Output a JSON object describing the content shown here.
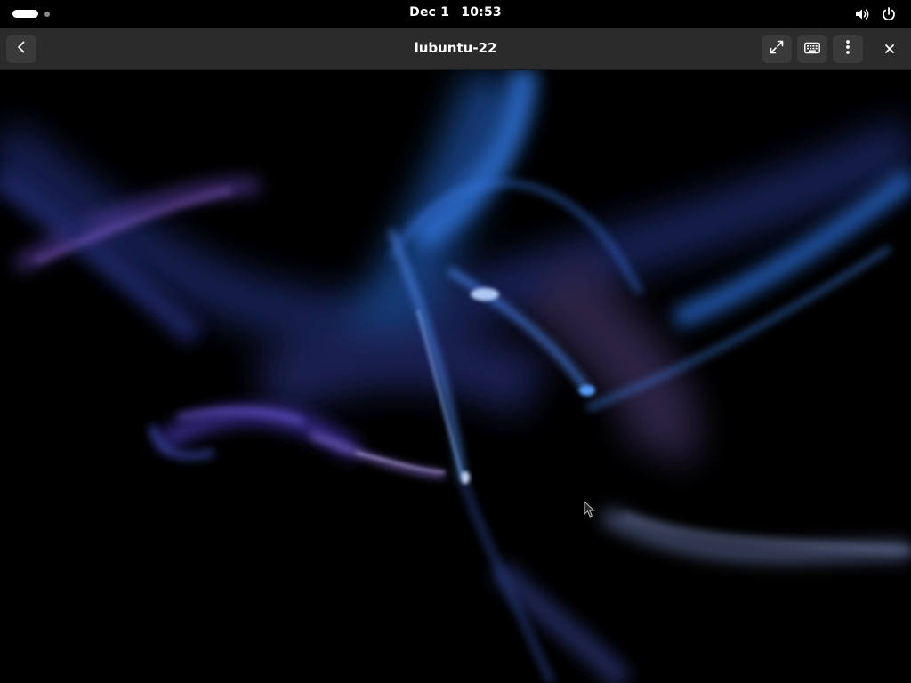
{
  "top_bar": {
    "date": "Dec 1",
    "time": "10:53"
  },
  "window": {
    "title": "lubuntu-22"
  },
  "icons": {
    "back": "go-back-icon",
    "fullscreen": "fullscreen-icon",
    "keyboard": "keyboard-icon",
    "menu": "kebab-menu-icon",
    "close": "close-icon",
    "volume": "speaker-icon",
    "power": "power-icon"
  },
  "colors": {
    "panel": "#000000",
    "headerbar": "#2b2b2b",
    "button": "#3a3a3a",
    "wallpaper_blue": "#3a7bd5",
    "wallpaper_violet": "#8a5cd8"
  }
}
